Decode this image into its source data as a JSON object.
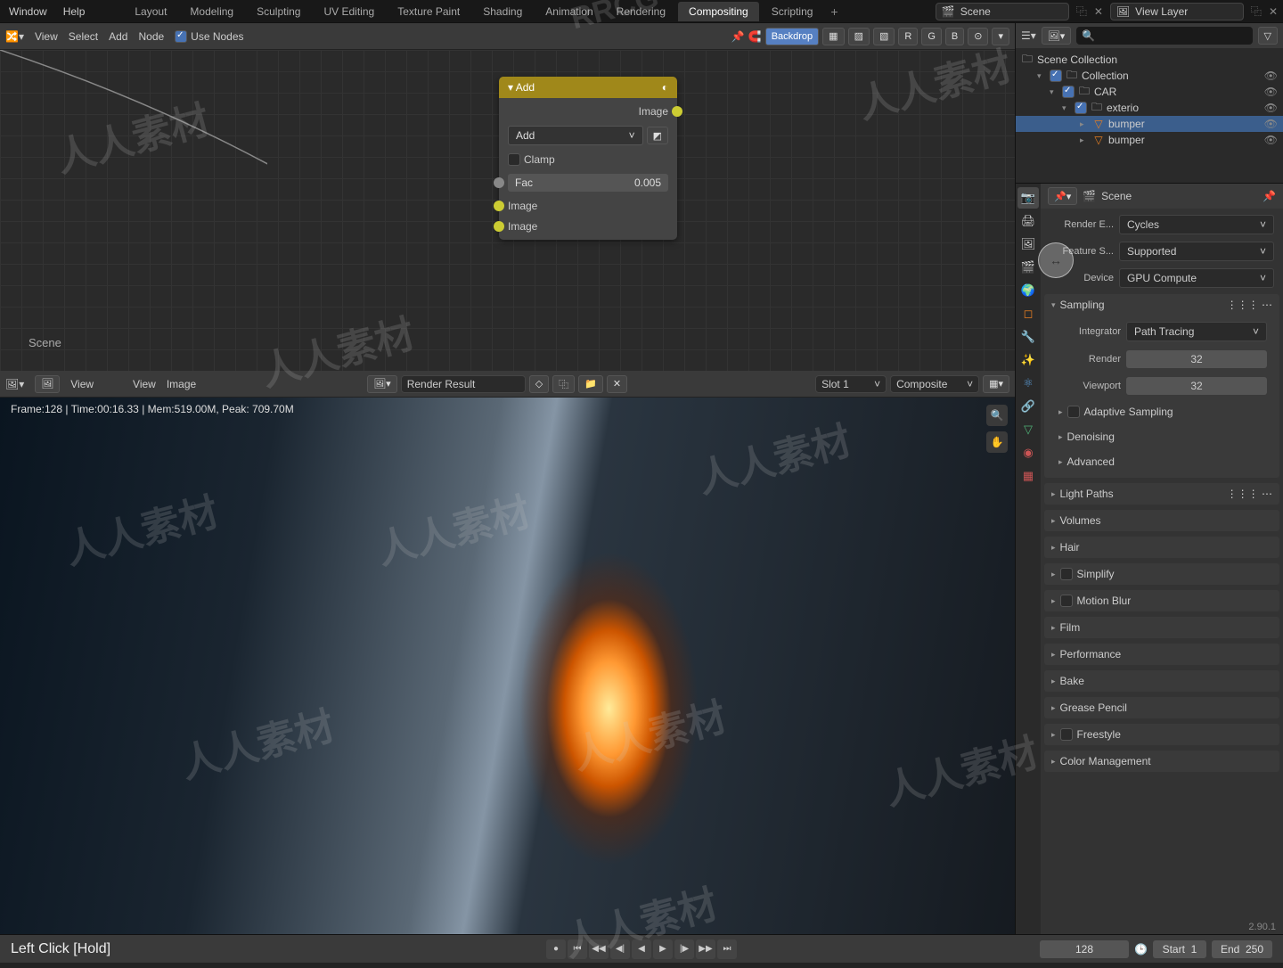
{
  "menu": {
    "window": "Window",
    "help": "Help"
  },
  "workspaces": [
    "Layout",
    "Modeling",
    "Sculpting",
    "UV Editing",
    "Texture Paint",
    "Shading",
    "Animation",
    "Rendering",
    "Compositing",
    "Scripting"
  ],
  "ws_active": "Compositing",
  "header": {
    "scene": "Scene",
    "viewlayer": "View Layer"
  },
  "node_toolbar": {
    "view": "View",
    "select": "Select",
    "add": "Add",
    "node": "Node",
    "use_nodes": "Use Nodes",
    "backdrop": "Backdrop"
  },
  "node": {
    "title": "Add",
    "out_image": "Image",
    "mode": "Add",
    "clamp": "Clamp",
    "fac_label": "Fac",
    "fac_value": "0.005",
    "in_image1": "Image",
    "in_image2": "Image"
  },
  "scene_label": "Scene",
  "img_toolbar": {
    "view1": "View",
    "view2": "View",
    "image": "Image",
    "render_result": "Render Result",
    "slot": "Slot 1",
    "pass": "Composite"
  },
  "render_info": "Frame:128 | Time:00:16.33 | Mem:519.00M, Peak: 709.70M",
  "outliner": {
    "root": "Scene Collection",
    "collection": "Collection",
    "car": "CAR",
    "exterio": "exterio",
    "bumper1": "bumper",
    "bumper2": "bumper"
  },
  "props": {
    "scene": "Scene",
    "render_engine_label": "Render E...",
    "render_engine": "Cycles",
    "feature_set_label": "Feature S...",
    "feature_set": "Supported",
    "device_label": "Device",
    "device": "GPU Compute",
    "sampling": "Sampling",
    "integrator_label": "Integrator",
    "integrator": "Path Tracing",
    "render_label": "Render",
    "render_samples": "32",
    "viewport_label": "Viewport",
    "viewport_samples": "32",
    "adaptive": "Adaptive Sampling",
    "denoising": "Denoising",
    "advanced": "Advanced",
    "light_paths": "Light Paths",
    "volumes": "Volumes",
    "hair": "Hair",
    "simplify": "Simplify",
    "motion_blur": "Motion Blur",
    "film": "Film",
    "performance": "Performance",
    "bake": "Bake",
    "grease_pencil": "Grease Pencil",
    "freestyle": "Freestyle",
    "color_mgmt": "Color Management"
  },
  "timeline": {
    "frame": "128",
    "start_label": "Start",
    "start": "1",
    "end_label": "End",
    "end": "250"
  },
  "status_hint": "Left Click [Hold]",
  "version": "2.90.1",
  "watermark": "人人素材",
  "watermark2": "RRCG"
}
